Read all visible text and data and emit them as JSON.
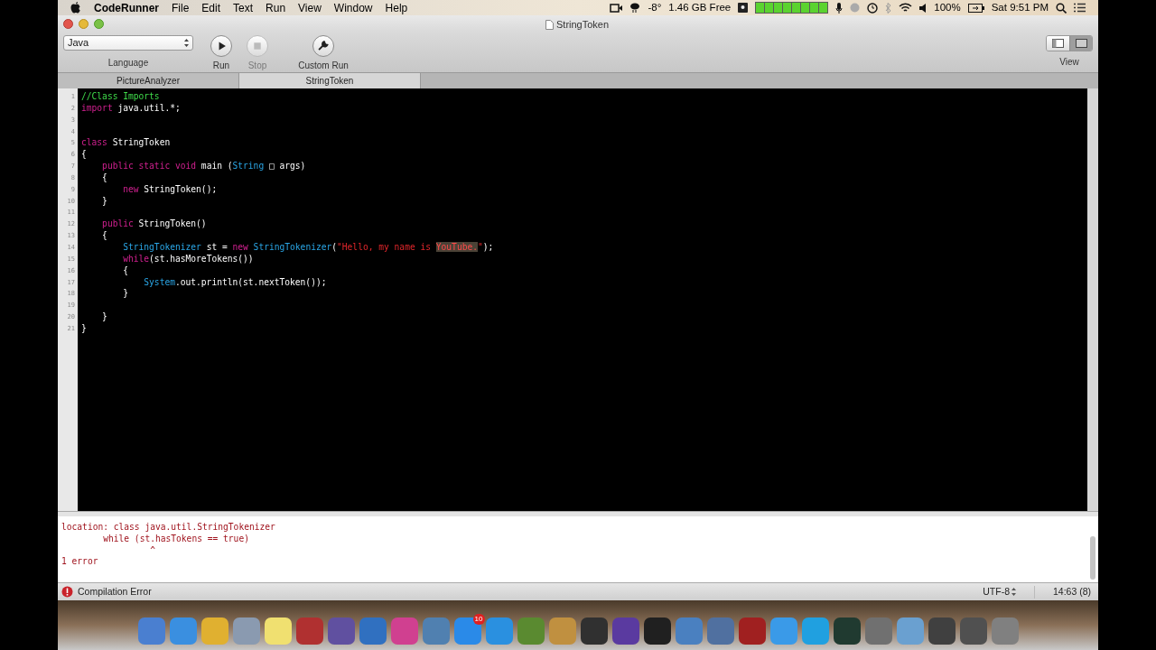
{
  "menu_bar": {
    "app": "CodeRunner",
    "menus": [
      "File",
      "Edit",
      "Text",
      "Run",
      "View",
      "Window",
      "Help"
    ],
    "temperature": "-8°",
    "memory": "1.46 GB Free",
    "battery": "100%",
    "clock": "Sat 9:51 PM"
  },
  "window": {
    "title": "StringToken"
  },
  "toolbar": {
    "language": {
      "value": "Java",
      "label": "Language"
    },
    "buttons": [
      {
        "kind": "run",
        "label": "Run",
        "disabled": false
      },
      {
        "kind": "stop",
        "label": "Stop",
        "disabled": true
      },
      {
        "kind": "custom",
        "label": "Custom Run",
        "disabled": false
      }
    ],
    "view_label": "View"
  },
  "tabs": [
    {
      "label": "PictureAnalyzer",
      "selected": false
    },
    {
      "label": "StringToken",
      "selected": true
    }
  ],
  "editor": {
    "lines": [
      {
        "number": "1",
        "tokens": [
          {
            "kind": "comment",
            "text": "//Class Imports"
          }
        ]
      },
      {
        "number": "2",
        "tokens": [
          {
            "kind": "keyword",
            "text": "import"
          },
          {
            "kind": "plain",
            "text": " java.util.*;"
          }
        ]
      },
      {
        "number": "3"
      },
      {
        "number": "4"
      },
      {
        "number": "5",
        "tokens": [
          {
            "kind": "keyword",
            "text": "class"
          },
          {
            "kind": "plain",
            "text": " StringToken"
          }
        ]
      },
      {
        "number": "6",
        "tokens": [
          {
            "kind": "plain",
            "text": "{"
          }
        ]
      },
      {
        "number": "7",
        "tokens": [
          {
            "kind": "keyword",
            "text": "    public static void"
          },
          {
            "kind": "plain",
            "text": " main ("
          },
          {
            "kind": "type",
            "text": "String"
          },
          {
            "kind": "plain",
            "text": " □ args)"
          }
        ]
      },
      {
        "number": "8",
        "tokens": [
          {
            "kind": "plain",
            "text": "    {"
          }
        ]
      },
      {
        "number": "9",
        "tokens": [
          {
            "kind": "keyword",
            "text": "        new"
          },
          {
            "kind": "plain",
            "text": " StringToken();"
          }
        ]
      },
      {
        "number": "10",
        "tokens": [
          {
            "kind": "plain",
            "text": "    }"
          }
        ]
      },
      {
        "number": "11"
      },
      {
        "number": "12",
        "tokens": [
          {
            "kind": "keyword",
            "text": "    public"
          },
          {
            "kind": "plain",
            "text": " StringToken()"
          }
        ]
      },
      {
        "number": "13",
        "tokens": [
          {
            "kind": "plain",
            "text": "    {"
          }
        ]
      },
      {
        "number": "14",
        "tokens": [
          {
            "kind": "type",
            "text": "        StringTokenizer"
          },
          {
            "kind": "plain",
            "text": " st = "
          },
          {
            "kind": "keyword",
            "text": "new"
          },
          {
            "kind": "type",
            "text": " StringTokenizer"
          },
          {
            "kind": "plain",
            "text": "("
          },
          {
            "kind": "string",
            "text": "\"Hello, my name is "
          },
          {
            "kind": "highlight",
            "text": "YouTube."
          },
          {
            "kind": "string",
            "text": "\""
          },
          {
            "kind": "plain",
            "text": ");"
          }
        ]
      },
      {
        "number": "15",
        "tokens": [
          {
            "kind": "keyword",
            "text": "        while"
          },
          {
            "kind": "plain",
            "text": "(st.hasMoreTokens())"
          }
        ]
      },
      {
        "number": "16",
        "tokens": [
          {
            "kind": "plain",
            "text": "        {"
          }
        ]
      },
      {
        "number": "17",
        "tokens": [
          {
            "kind": "type",
            "text": "            System"
          },
          {
            "kind": "plain",
            "text": ".out.println(st.nextToken());"
          }
        ]
      },
      {
        "number": "18",
        "tokens": [
          {
            "kind": "plain",
            "text": "        }"
          }
        ]
      },
      {
        "number": "19"
      },
      {
        "number": "20",
        "tokens": [
          {
            "kind": "plain",
            "text": "    }"
          }
        ]
      },
      {
        "number": "21",
        "tokens": [
          {
            "kind": "plain",
            "text": "}"
          }
        ]
      }
    ]
  },
  "output": {
    "lines": [
      "location: class java.util.StringTokenizer",
      "        while (st.hasTokens == true)",
      "                 ^",
      "1 error"
    ]
  },
  "status_bar": {
    "message": "Compilation Error",
    "encoding": "UTF-8",
    "position": "14:63 (8)"
  },
  "dock": {
    "badge": "10"
  }
}
